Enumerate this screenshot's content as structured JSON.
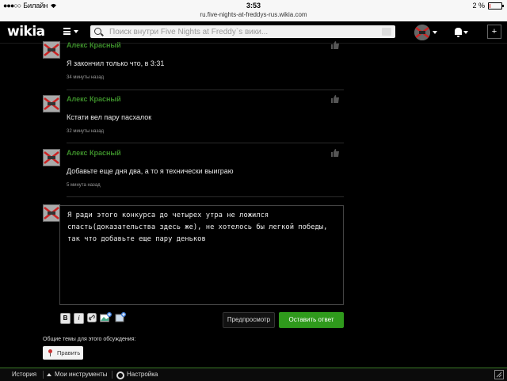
{
  "status_bar": {
    "carrier": "Билайн",
    "time": "3:53",
    "url": "ru.five-nights-at-freddys-rus.wikia.com",
    "battery": "2 %",
    "battery_level": 0.02
  },
  "header": {
    "logo": "wikia",
    "search_placeholder": "Поиск внутри Five Nights at Freddy`s вики...",
    "plus": "+"
  },
  "comments": [
    {
      "author": "Алекс Красный",
      "text": "Я закончил только что, в 3:31",
      "time": "34 минуты назад"
    },
    {
      "author": "Алекс Красный",
      "text": "Кстати вел пару пасхалок",
      "time": "32 минуты назад"
    },
    {
      "author": "Алекс Красный",
      "text": "Добавьте еще дня два, а то я технически выиграю",
      "time": "5 минута назад"
    }
  ],
  "reply": {
    "text": "Я ради этого конкурса до четырех утра не ложился\nспасть(доказательства здесь же), не хотелось бы легкой победы,\nтак что добавьте еще пару деньков",
    "bold_label": "B",
    "italic_label": "i",
    "preview_label": "Предпросмотр",
    "submit_label": "Оставить ответ"
  },
  "topics": {
    "label": "Общие темы для этого обсуждения:",
    "edit_label": "Править"
  },
  "toolbar": {
    "history": "История",
    "my_tools": "Мои инструменты",
    "settings": "Настройка"
  },
  "colors": {
    "accent_green": "#2f9a1c",
    "author_green": "#3c8e2a",
    "background": "#000000"
  }
}
